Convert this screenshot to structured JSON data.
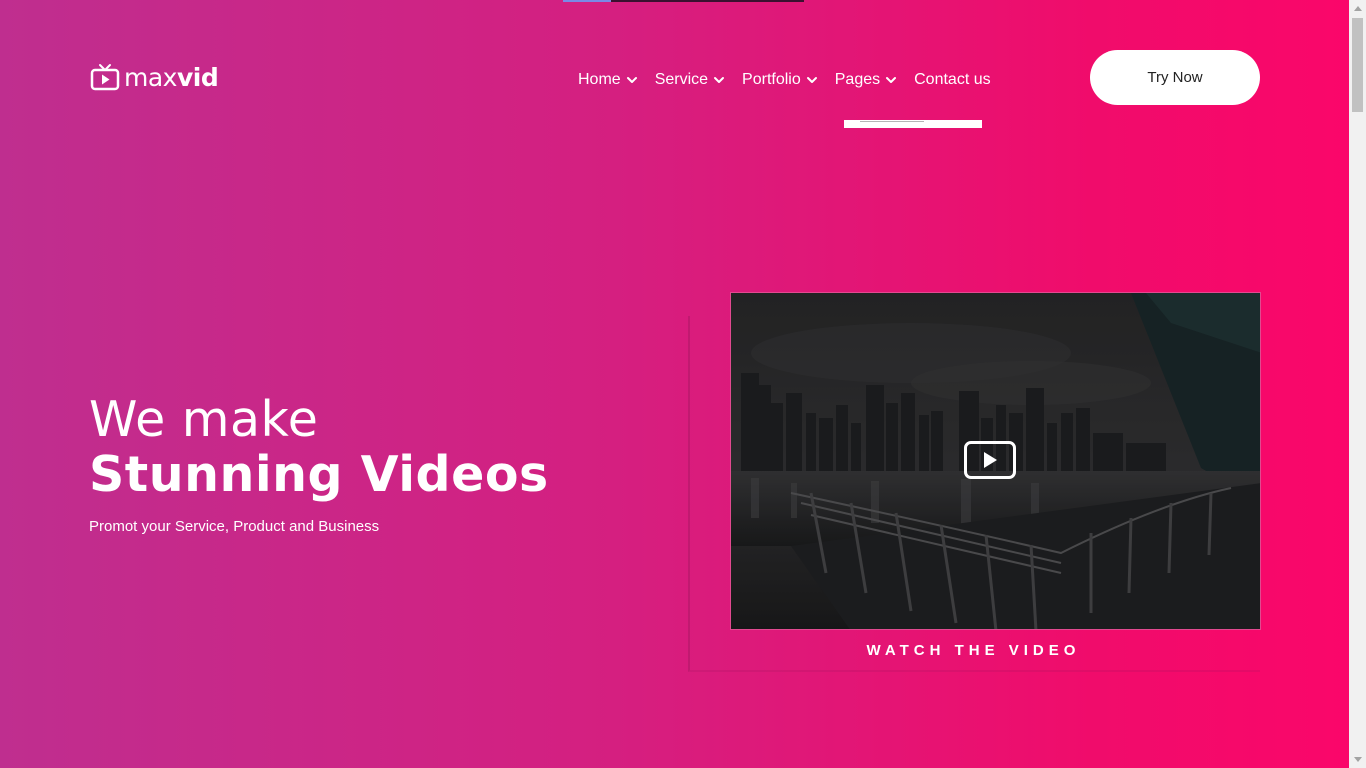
{
  "loading_bar": {
    "progress": 0.2
  },
  "logo": {
    "light": "max",
    "bold": "vid",
    "icon": "tv-play-icon"
  },
  "nav": {
    "items": [
      {
        "label": "Home",
        "has_dropdown": true
      },
      {
        "label": "Service",
        "has_dropdown": true
      },
      {
        "label": "Portfolio",
        "has_dropdown": true
      },
      {
        "label": "Pages",
        "has_dropdown": true
      },
      {
        "label": "Contact us",
        "has_dropdown": false
      }
    ]
  },
  "cta": {
    "label": "Try Now"
  },
  "hero": {
    "line1": "We make",
    "line2": "Stunning Videos",
    "subtitle": "Promot your Service, Product and Business"
  },
  "video": {
    "caption": "WATCH THE VIDEO",
    "icon": "play-icon"
  },
  "colors": {
    "gradient_start": "#bf2e8f",
    "gradient_end": "#fb066a",
    "button_bg": "#ffffff",
    "text": "#ffffff"
  }
}
